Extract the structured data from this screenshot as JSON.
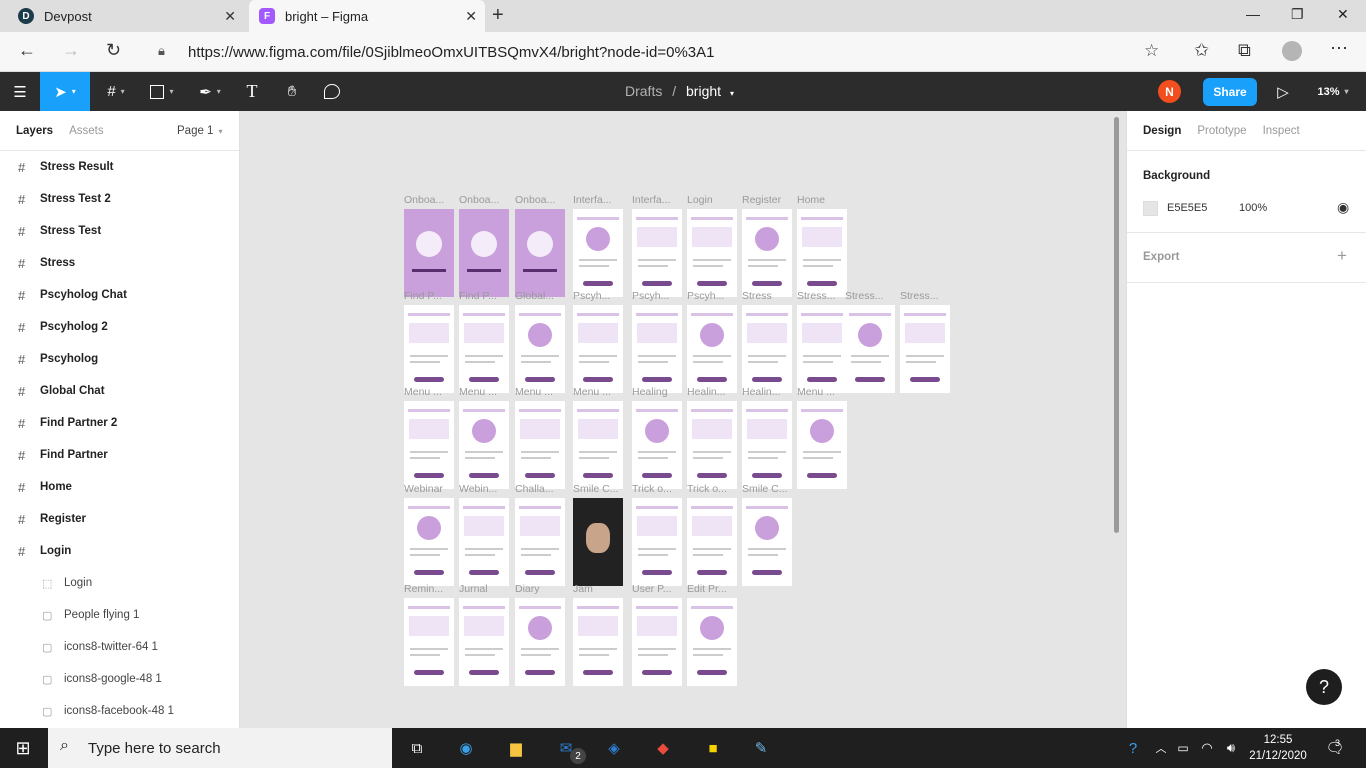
{
  "browser": {
    "tabs": [
      {
        "title": "Devpost",
        "favicon": "D"
      },
      {
        "title": "bright – Figma",
        "favicon": "F"
      }
    ],
    "url": "https://www.figma.com/file/0SjiblmeoOmxUITBSQmvX4/bright?node-id=0%3A1"
  },
  "figma": {
    "crumb_parent": "Drafts",
    "crumb_sep": "/",
    "file_name": "bright",
    "avatar_initial": "N",
    "share_label": "Share",
    "zoom": "13%",
    "colors": {
      "toolbar": "#2c2c2c",
      "accent": "#18a0fb",
      "avatar": "#f24e1e",
      "frame_purple": "#c9a0dc",
      "dark_purple": "#7a4a8f"
    }
  },
  "left_panel": {
    "tab_layers": "Layers",
    "tab_assets": "Assets",
    "page_label": "Page 1",
    "layers": [
      {
        "name": "Stress Result",
        "type": "frame"
      },
      {
        "name": "Stress Test 2",
        "type": "frame"
      },
      {
        "name": "Stress Test",
        "type": "frame"
      },
      {
        "name": "Stress",
        "type": "frame"
      },
      {
        "name": "Pscyholog Chat",
        "type": "frame"
      },
      {
        "name": "Pscyholog 2",
        "type": "frame"
      },
      {
        "name": "Pscyholog",
        "type": "frame"
      },
      {
        "name": "Global Chat",
        "type": "frame"
      },
      {
        "name": "Find Partner 2",
        "type": "frame"
      },
      {
        "name": "Find Partner",
        "type": "frame"
      },
      {
        "name": "Home",
        "type": "frame"
      },
      {
        "name": "Register",
        "type": "frame"
      },
      {
        "name": "Login",
        "type": "frame"
      },
      {
        "name": "Login",
        "type": "group"
      },
      {
        "name": "People flying 1",
        "type": "image"
      },
      {
        "name": "icons8-twitter-64 1",
        "type": "image"
      },
      {
        "name": "icons8-google-48 1",
        "type": "image"
      },
      {
        "name": "icons8-facebook-48 1",
        "type": "image"
      }
    ]
  },
  "right_panel": {
    "tab_design": "Design",
    "tab_prototype": "Prototype",
    "tab_inspect": "Inspect",
    "background_label": "Background",
    "bg_hex": "E5E5E5",
    "bg_opacity": "100%",
    "export_label": "Export",
    "export_add": "+"
  },
  "canvas": {
    "rows": [
      {
        "labels": [
          "Onboa...",
          "Onboa...",
          "Onboa...",
          "Interfa...",
          "Interfa...",
          "Login",
          "Register",
          "Home"
        ]
      },
      {
        "labels": [
          "Find P...",
          "Find P...",
          "Global...",
          "Pscyh...",
          "Pscyh...",
          "Pscyh...",
          "Stress",
          "Stress...",
          "Stress...",
          "Stress..."
        ]
      },
      {
        "labels": [
          "Menu ...",
          "Menu ...",
          "Menu ...",
          "Menu ...",
          "Healing",
          "Healin...",
          "Healin...",
          "Menu ..."
        ]
      },
      {
        "labels": [
          "Webinar",
          "Webin...",
          "Challa...",
          "Smile C...",
          "Trick o...",
          "Trick o...",
          "Smile C..."
        ]
      },
      {
        "labels": [
          "Remin...",
          "Jurnal",
          "Diary",
          "Jam",
          "User P...",
          "Edit Pr..."
        ]
      }
    ],
    "help_label": "?"
  },
  "taskbar": {
    "search_placeholder": "Type here to search",
    "time": "12:55",
    "date": "21/12/2020",
    "mail_badge": "2",
    "notif_count": "3"
  }
}
